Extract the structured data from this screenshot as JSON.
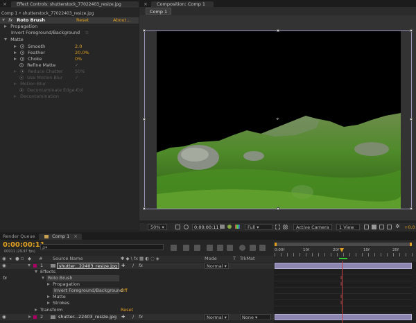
{
  "effect_panel": {
    "tab_title": "Effect Controls: shutterstock_77022403_resize.jpg",
    "breadcrumb": "Comp 1 • shutterstock_77022403_resize.jpg",
    "effect_prefix": "fx",
    "effect_name": "Roto Brush",
    "reset": "Reset",
    "about": "About...",
    "propagation": "Propagation",
    "invert": "Invert Foreground/Background",
    "matte": "Matte",
    "smooth_label": "Smooth",
    "smooth_value": "2.0",
    "feather_label": "Feather",
    "feather_value": "20.0%",
    "choke_label": "Choke",
    "choke_value": "0%",
    "refine_label": "Refine Matte",
    "reduce_label": "Reduce Chatter",
    "reduce_value": "50%",
    "motion_label": "Use Motion Blur",
    "motion_blur": "Motion Blur",
    "decon_label": "Decontaminate Edge Col",
    "decontamination": "Decontamination"
  },
  "comp_panel": {
    "tab_title": "Composition: Comp 1",
    "subtab": "Comp 1",
    "zoom": "50%",
    "timecode": "0:00:00:11",
    "resolution": "Full",
    "camera": "Active Camera",
    "view": "1 View",
    "exposure": "+0.0"
  },
  "timeline": {
    "render_tab": "Render Queue",
    "comp_tab": "Comp 1",
    "timecode": "0:00:00:11",
    "fps": "00011 (29.97 fps)",
    "search_placeholder": "ρ▾",
    "col_source": "Source Name",
    "col_mode": "Mode",
    "col_t": "T",
    "col_trkmat": "TrkMat",
    "ruler": [
      "0:00f",
      "10f",
      "20f",
      "10f",
      "20f"
    ],
    "layer1_num": "1",
    "layer1_name": "shutter...22403_resize.jpg",
    "layer1_mode": "Normal",
    "effects": "Effects",
    "roto": "Roto Brush",
    "propagation": "Propagation",
    "invert": "Invert Foreground/Background",
    "invert_value": "Off",
    "matte": "Matte",
    "strokes": "Strokes",
    "transform": "Transform",
    "transform_reset": "Reset",
    "layer2_num": "2",
    "layer2_name": "shutter...22403_resize.jpg",
    "layer2_mode": "Normal",
    "layer2_trkmat": "None",
    "fx_label": "fx"
  }
}
